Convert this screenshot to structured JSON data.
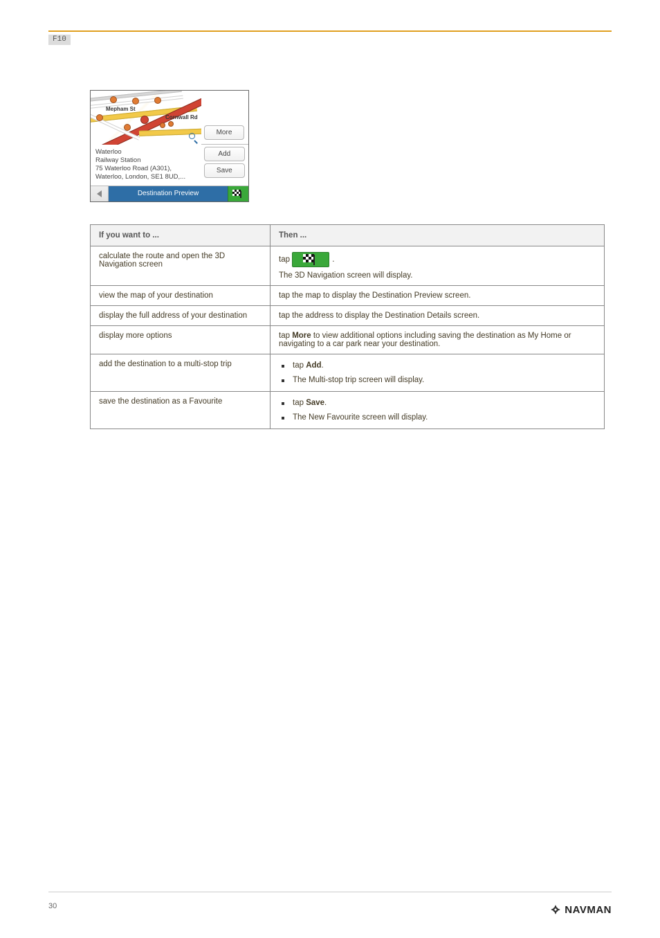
{
  "page": {
    "label": "F10",
    "number": "30"
  },
  "screenshot": {
    "map": {
      "street_top": "Mepham St",
      "street_right": "Cornwall Rd"
    },
    "side_buttons": {
      "more": "More",
      "add": "Add",
      "save": "Save"
    },
    "info": {
      "line1": "Waterloo",
      "line2": "Railway Station",
      "line3": "75 Waterloo Road (A301),",
      "line4": "Waterloo, London, SE1 8UD,..."
    },
    "footer_title": "Destination Preview"
  },
  "table": {
    "headers": {
      "a": "If you want to ...",
      "b": "Then ..."
    },
    "rows": [
      {
        "a": "calculate the route and open the 3D Navigation screen",
        "b_prefix": "tap",
        "b_suffix": ".",
        "b_note": "The 3D Navigation screen will display."
      },
      {
        "a": "view the map of your destination",
        "b": "tap the map to display the Destination Preview screen."
      },
      {
        "a": "display the full address of your destination",
        "b": "tap the address to display the Destination Details screen."
      },
      {
        "a": "display more options",
        "b_strong": "More",
        "b_prefix": "tap ",
        "b_suffix": " to view additional options including saving the destination as My Home or navigating to a car park near your destination."
      },
      {
        "a": "add the destination to a multi-stop trip",
        "b_items": [
          {
            "prefix": "tap ",
            "strong": "Add",
            "suffix": "."
          },
          {
            "text": "The Multi-stop trip screen will display."
          }
        ]
      },
      {
        "a": "save the destination as a Favourite",
        "b_items": [
          {
            "prefix": "tap ",
            "strong": "Save",
            "suffix": "."
          },
          {
            "text": "The New Favourite screen will display."
          }
        ]
      }
    ]
  },
  "brand": "NAVMAN"
}
